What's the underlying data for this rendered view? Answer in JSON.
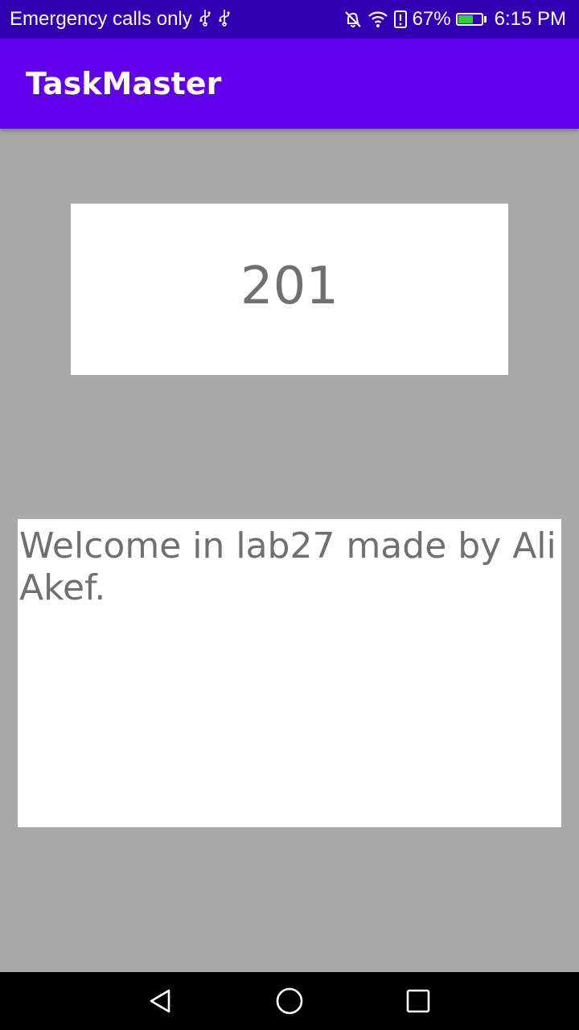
{
  "status_bar": {
    "carrier_text": "Emergency calls only",
    "battery_percent_text": "67%",
    "battery_level": 0.67,
    "time": "6:15 PM",
    "icons": [
      "usb-icon",
      "usb-icon",
      "mute-icon",
      "wifi-icon",
      "storage-alert-icon",
      "battery-icon"
    ],
    "battery_fill_color": "#2ecc40"
  },
  "app_bar": {
    "title": "TaskMaster",
    "color": "#6200ee"
  },
  "main": {
    "count_value": "201",
    "welcome_text": "Welcome in lab27 made by Ali Akef."
  },
  "nav_bar": {
    "icons": [
      "back-icon",
      "home-icon",
      "recents-icon"
    ]
  },
  "colors": {
    "status_bar": "#3200b3",
    "background": "#a9a9a9",
    "text_gray": "#707070"
  }
}
